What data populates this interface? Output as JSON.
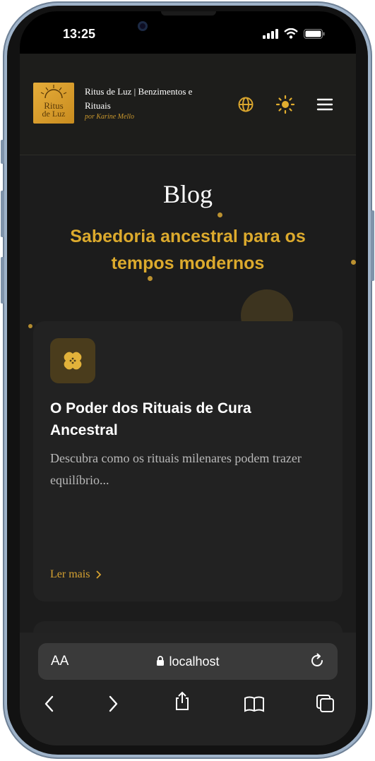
{
  "status_bar": {
    "time": "13:25"
  },
  "header": {
    "logo_text_line1": "Ritus",
    "logo_text_line2": "de Luz",
    "site_title": "Ritus de Luz | Benzimentos e Rituais",
    "byline": "por Karine Mello",
    "icons": [
      "globe-icon",
      "sun-icon",
      "menu-icon"
    ]
  },
  "page": {
    "title": "Blog",
    "subtitle": "Sabedoria ancestral para os tempos modernos"
  },
  "posts": [
    {
      "title": "O Poder dos Rituais de Cura Ancestral",
      "excerpt": "Descubra como os rituais milenares podem trazer equilíbrio...",
      "link_label": "Ler mais",
      "icon": "bandage-icon"
    }
  ],
  "browser": {
    "aa_label": "AA",
    "url": "localhost"
  },
  "colors": {
    "accent": "#dcaa2d",
    "background": "#1c1c1c",
    "card": "#222222"
  }
}
